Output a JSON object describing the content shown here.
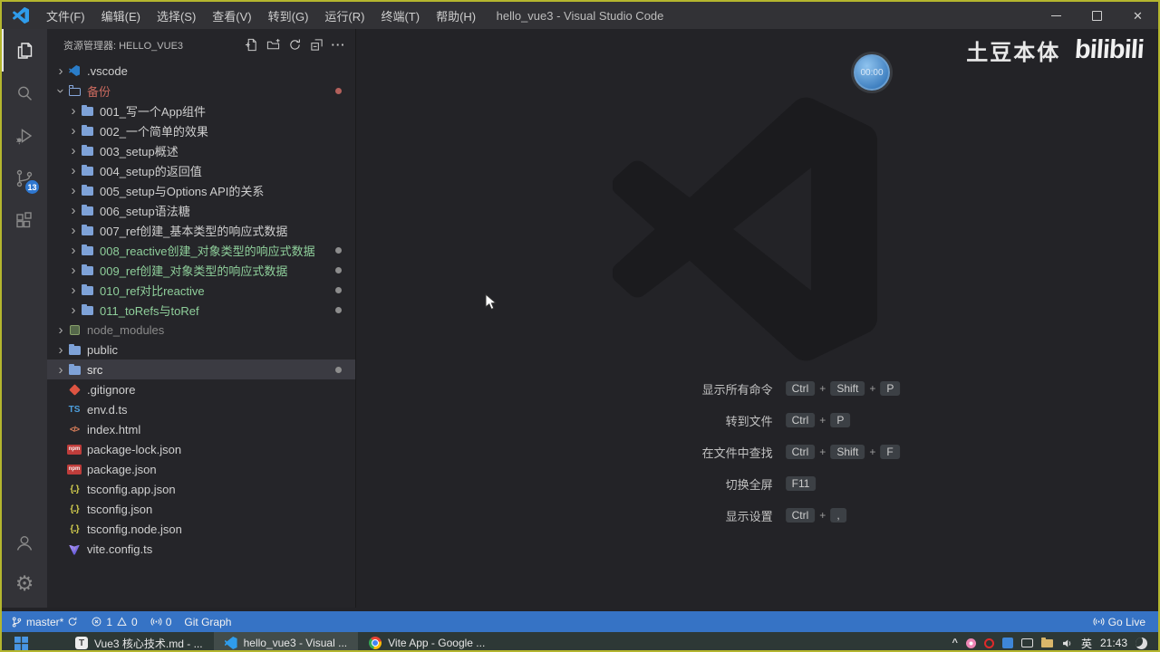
{
  "window": {
    "title": "hello_vue3 - Visual Studio Code",
    "menus": [
      "文件(F)",
      "编辑(E)",
      "选择(S)",
      "查看(V)",
      "转到(G)",
      "运行(R)",
      "终端(T)",
      "帮助(H)"
    ]
  },
  "activity_bar": {
    "icons": [
      "explorer-icon",
      "search-icon",
      "run-debug-icon",
      "source-control-icon",
      "extensions-icon",
      "account-icon",
      "settings-gear-icon"
    ],
    "active_item": "explorer",
    "scm_badge": "13"
  },
  "sidebar": {
    "header": {
      "title": "资源管理器: HELLO_VUE3",
      "actions": [
        "new-file-icon",
        "new-folder-icon",
        "refresh-explorer-icon",
        "collapse-folders-icon",
        "more-actions-icon"
      ]
    },
    "tree": [
      {
        "label": ".vscode",
        "classes": "lvl1 chev-right",
        "icon": "icon-vscode",
        "dot": "dot-none"
      },
      {
        "label": "备份",
        "classes": "lvl1 chev-down git-red",
        "icon": "icon-folder-open",
        "dot": "dot-red"
      },
      {
        "label": "001_写一个App组件",
        "classes": "lvl2 chev-right",
        "icon": "icon-folder",
        "dot": "dot-none"
      },
      {
        "label": "002_一个简单的效果",
        "classes": "lvl2 chev-right",
        "icon": "icon-folder",
        "dot": "dot-none"
      },
      {
        "label": "003_setup概述",
        "classes": "lvl2 chev-right",
        "icon": "icon-folder",
        "dot": "dot-none"
      },
      {
        "label": "004_setup的返回值",
        "classes": "lvl2 chev-right",
        "icon": "icon-folder",
        "dot": "dot-none"
      },
      {
        "label": "005_setup与Options API的关系",
        "classes": "lvl2 chev-right",
        "icon": "icon-folder",
        "dot": "dot-none"
      },
      {
        "label": "006_setup语法糖",
        "classes": "lvl2 chev-right",
        "icon": "icon-folder",
        "dot": "dot-none"
      },
      {
        "label": "007_ref创建_基本类型的响应式数据",
        "classes": "lvl2 chev-right",
        "icon": "icon-folder",
        "dot": "dot-none"
      },
      {
        "label": "008_reactive创建_对象类型的响应式数据",
        "classes": "lvl2 chev-right git-green",
        "icon": "icon-folder",
        "dot": "dot-grey"
      },
      {
        "label": "009_ref创建_对象类型的响应式数据",
        "classes": "lvl2 chev-right git-green",
        "icon": "icon-folder",
        "dot": "dot-grey"
      },
      {
        "label": "010_ref对比reactive",
        "classes": "lvl2 chev-right git-green",
        "icon": "icon-folder",
        "dot": "dot-grey"
      },
      {
        "label": "011_toRefs与toRef",
        "classes": "lvl2 chev-right git-green",
        "icon": "icon-folder",
        "dot": "dot-grey"
      },
      {
        "label": "node_modules",
        "classes": "lvl1 chev-right git-ignored",
        "icon": "icon-package",
        "dot": "dot-none"
      },
      {
        "label": "public",
        "classes": "lvl1 chev-right",
        "icon": "icon-folder",
        "dot": "dot-none"
      },
      {
        "label": "src",
        "classes": "lvl1 chev-right sel",
        "icon": "icon-folder",
        "dot": "dot-grey"
      },
      {
        "label": ".gitignore",
        "classes": "lvl1 chev-none",
        "icon": "icon-git",
        "dot": "dot-none"
      },
      {
        "label": "env.d.ts",
        "classes": "lvl1 chev-none",
        "icon": "icon-ts",
        "dot": "dot-none"
      },
      {
        "label": "index.html",
        "classes": "lvl1 chev-none",
        "icon": "icon-html",
        "dot": "dot-none"
      },
      {
        "label": "package-lock.json",
        "classes": "lvl1 chev-none",
        "icon": "icon-npm",
        "dot": "dot-none"
      },
      {
        "label": "package.json",
        "classes": "lvl1 chev-none",
        "icon": "icon-npm",
        "dot": "dot-none"
      },
      {
        "label": "tsconfig.app.json",
        "classes": "lvl1 chev-none",
        "icon": "icon-json",
        "dot": "dot-none"
      },
      {
        "label": "tsconfig.json",
        "classes": "lvl1 chev-none",
        "icon": "icon-json",
        "dot": "dot-none"
      },
      {
        "label": "tsconfig.node.json",
        "classes": "lvl1 chev-none",
        "icon": "icon-json",
        "dot": "dot-none"
      },
      {
        "label": "vite.config.ts",
        "classes": "lvl1 chev-none",
        "icon": "icon-vite",
        "dot": "dot-none"
      }
    ]
  },
  "editor": {
    "timer": "00:00",
    "watermark": {
      "left": "土豆本体",
      "right": "bilibili"
    },
    "shortcuts": [
      {
        "label": "显示所有命令",
        "keys": [
          "Ctrl",
          "Shift",
          "P"
        ]
      },
      {
        "label": "转到文件",
        "keys": [
          "Ctrl",
          "P"
        ]
      },
      {
        "label": "在文件中查找",
        "keys": [
          "Ctrl",
          "Shift",
          "F"
        ]
      },
      {
        "label": "切换全屏",
        "keys": [
          "F11"
        ]
      },
      {
        "label": "显示设置",
        "keys": [
          "Ctrl",
          ","
        ]
      }
    ]
  },
  "status_bar": {
    "left": {
      "branch": "master*",
      "errors": "1",
      "warnings": "0",
      "ports": "0",
      "git_graph": "Git Graph"
    },
    "right": {
      "go_live": "Go Live"
    }
  },
  "taskbar": {
    "apps": [
      {
        "label": "Vue3 核心技术.md - ...",
        "icon": "ti-typora",
        "classes": ""
      },
      {
        "label": "hello_vue3 - Visual ...",
        "icon": "ti-vscode",
        "classes": "active"
      },
      {
        "label": "Vite App - Google ...",
        "icon": "ti-chrome",
        "classes": ""
      }
    ],
    "tray": {
      "icons": [
        "tray-expand-icon",
        "flower-tray-icon",
        "opera-tray-icon",
        "blue-app-tray-icon",
        "monitor-tray-icon",
        "folder-tray-icon",
        "speaker-tray-icon",
        "notification-tray-icon"
      ],
      "language": "英",
      "time": "21:43"
    }
  },
  "colors": {
    "status_bar_bg": "#3673c5",
    "accent_blue": "#2f9ceb",
    "git_untracked_green": "#8fcf9b",
    "git_conflict_red": "#c8695e",
    "selected_row_bg": "#3b3b42",
    "frame_border": "#b4b62e",
    "scm_badge_bg": "#2e77d0"
  }
}
